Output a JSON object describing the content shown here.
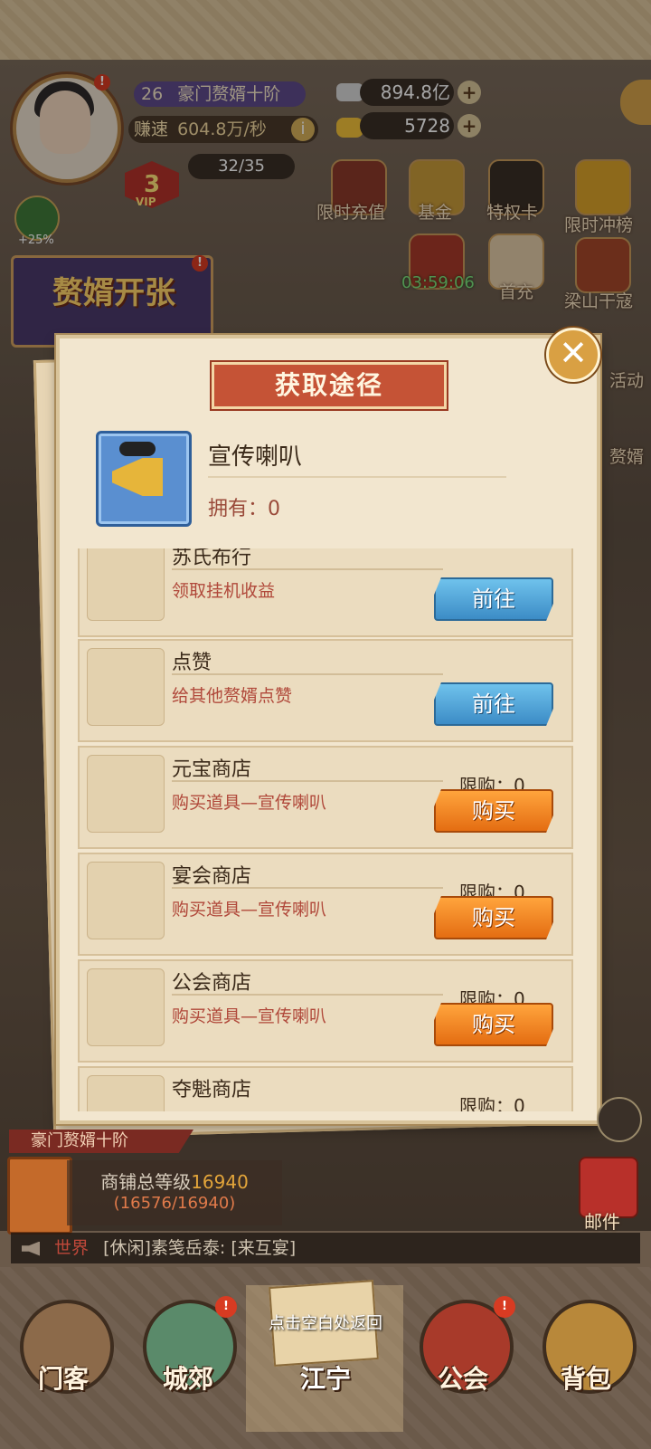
{
  "hud": {
    "rank_level": "26",
    "rank_title": "豪门赘婿十阶",
    "earn_label": "赚速",
    "earn_value": "604.8万/秒",
    "info_icon": "i",
    "silver": "894.8亿",
    "gold": "5728",
    "vip_level": "3",
    "vip_label": "VIP",
    "stamina": "32/35",
    "boost": "+25%",
    "plus": "+"
  },
  "event_icons": [
    {
      "label": "限时充值"
    },
    {
      "label": "基金"
    },
    {
      "label": "特权卡"
    },
    {
      "label": "限时冲榜"
    },
    {
      "label": "首充"
    },
    {
      "label": "梁山干寇"
    },
    {
      "label": "活动"
    },
    {
      "label": "赘婿"
    }
  ],
  "event_timer": "03:59:06",
  "banner": {
    "title": "赘婿开张"
  },
  "dialog": {
    "title": "获取途径",
    "item_name": "宣传喇叭",
    "own_label": "拥有：0",
    "close_symbol": "✕",
    "sources": [
      {
        "name": "苏氏布行",
        "desc": "领取挂机收益",
        "limit": "",
        "button": "前往",
        "button_type": "goto"
      },
      {
        "name": "点赞",
        "desc": "给其他赘婿点赞",
        "limit": "",
        "button": "前往",
        "button_type": "goto"
      },
      {
        "name": "元宝商店",
        "desc": "购买道具—宣传喇叭",
        "limit": "限购：0",
        "button": "购买",
        "button_type": "buy"
      },
      {
        "name": "宴会商店",
        "desc": "购买道具—宣传喇叭",
        "limit": "限购：0",
        "button": "购买",
        "button_type": "buy"
      },
      {
        "name": "公会商店",
        "desc": "购买道具—宣传喇叭",
        "limit": "限购：0",
        "button": "购买",
        "button_type": "buy"
      },
      {
        "name": "夺魁商店",
        "desc": "",
        "limit": "限购：0",
        "button": "",
        "button_type": "buy"
      }
    ]
  },
  "bottom": {
    "rank_ribbon": "豪门赘婿十阶",
    "shop_level_label": "商铺总等级",
    "shop_level_value": "16940",
    "shop_level_progress": "(16576/16940)",
    "mail_label": "邮件",
    "chat_channel": "世界",
    "chat_text": "[休闲]素笺岳泰: [来互宴]",
    "tap_hint": "点击空白处返回"
  },
  "nav": [
    {
      "label": "门客"
    },
    {
      "label": "城郊"
    },
    {
      "label": "江宁"
    },
    {
      "label": "公会"
    },
    {
      "label": "背包"
    }
  ],
  "colors": {
    "panel_bg": "#f2e6cf",
    "title_red": "#c55336",
    "goto_blue": "#3c8cc6",
    "buy_orange": "#e46d12",
    "desc_red": "#b0483a"
  }
}
